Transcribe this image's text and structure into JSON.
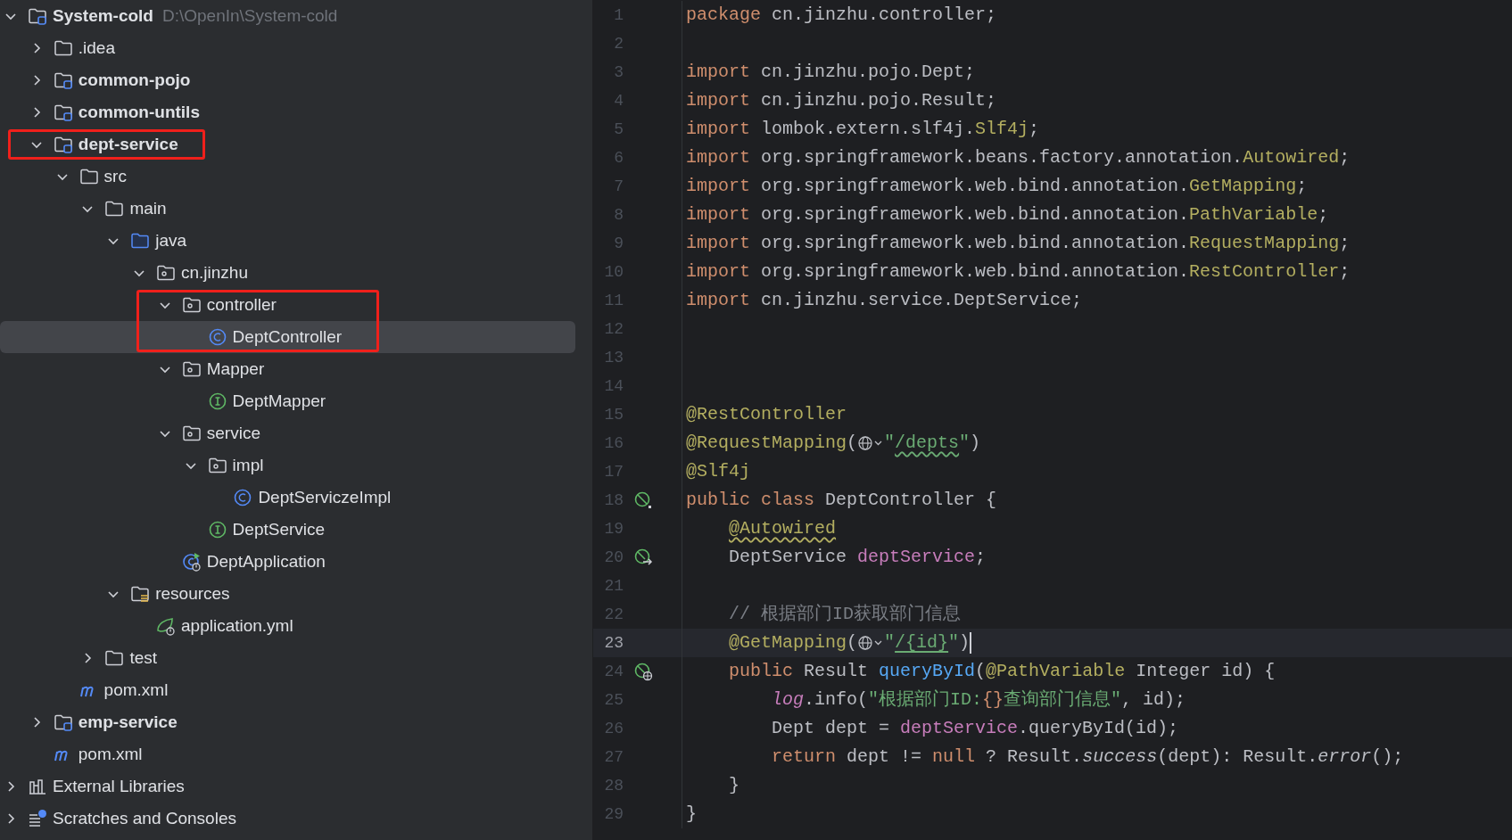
{
  "project_tree": [
    {
      "label": "System-cold",
      "path": "D:\\OpenIn\\System-cold",
      "kind": "module",
      "expanded": true,
      "selected": false,
      "outlined": false,
      "children": [
        {
          "label": ".idea",
          "kind": "folder",
          "expanded": false,
          "selected": false,
          "outlined": false
        },
        {
          "label": "common-pojo",
          "kind": "module",
          "expanded": false,
          "selected": false,
          "outlined": false
        },
        {
          "label": "common-untils",
          "kind": "module",
          "expanded": false,
          "selected": false,
          "outlined": false
        },
        {
          "label": "dept-service",
          "kind": "module",
          "expanded": true,
          "selected": false,
          "outlined": true,
          "children": [
            {
              "label": "src",
              "kind": "folder",
              "expanded": true,
              "selected": false,
              "outlined": false,
              "children": [
                {
                  "label": "main",
                  "kind": "folder",
                  "expanded": true,
                  "selected": false,
                  "outlined": false,
                  "children": [
                    {
                      "label": "java",
                      "kind": "source-root",
                      "expanded": true,
                      "selected": false,
                      "outlined": false,
                      "children": [
                        {
                          "label": "cn.jinzhu",
                          "kind": "package",
                          "expanded": true,
                          "selected": false,
                          "outlined": false,
                          "children": [
                            {
                              "label": "controller",
                              "kind": "package",
                              "expanded": true,
                              "selected": false,
                              "outlined": true,
                              "children": [
                                {
                                  "label": "DeptController",
                                  "kind": "class",
                                  "selected": true,
                                  "outlined": true
                                }
                              ]
                            },
                            {
                              "label": "Mapper",
                              "kind": "package",
                              "expanded": true,
                              "selected": false,
                              "outlined": false,
                              "children": [
                                {
                                  "label": "DeptMapper",
                                  "kind": "interface",
                                  "selected": false,
                                  "outlined": false
                                }
                              ]
                            },
                            {
                              "label": "service",
                              "kind": "package",
                              "expanded": true,
                              "selected": false,
                              "outlined": false,
                              "children": [
                                {
                                  "label": "impl",
                                  "kind": "package",
                                  "expanded": true,
                                  "selected": false,
                                  "outlined": false,
                                  "children": [
                                    {
                                      "label": "DeptServiczeImpl",
                                      "kind": "class",
                                      "selected": false,
                                      "outlined": false
                                    }
                                  ]
                                },
                                {
                                  "label": "DeptService",
                                  "kind": "interface",
                                  "selected": false,
                                  "outlined": false
                                }
                              ]
                            },
                            {
                              "label": "DeptApplication",
                              "kind": "app-class",
                              "selected": false,
                              "outlined": false
                            }
                          ]
                        }
                      ]
                    },
                    {
                      "label": "resources",
                      "kind": "resources",
                      "expanded": true,
                      "selected": false,
                      "outlined": false,
                      "children": [
                        {
                          "label": "application.yml",
                          "kind": "yml",
                          "selected": false,
                          "outlined": false
                        }
                      ]
                    }
                  ]
                },
                {
                  "label": "test",
                  "kind": "folder",
                  "expanded": false,
                  "selected": false,
                  "outlined": false
                }
              ]
            },
            {
              "label": "pom.xml",
              "kind": "maven",
              "selected": false,
              "outlined": false
            }
          ]
        },
        {
          "label": "emp-service",
          "kind": "module",
          "expanded": false,
          "selected": false,
          "outlined": false
        },
        {
          "label": "pom.xml",
          "kind": "maven",
          "selected": false,
          "outlined": false
        }
      ]
    },
    {
      "label": "External Libraries",
      "kind": "libraries",
      "expanded": false,
      "selected": false,
      "outlined": false
    },
    {
      "label": "Scratches and Consoles",
      "kind": "scratches",
      "expanded": false,
      "selected": false,
      "outlined": false
    }
  ],
  "editor": {
    "lines": [
      {
        "number": "1",
        "current": false,
        "tokens": [
          {
            "kind": "kw",
            "t": "package"
          },
          {
            "kind": "plain",
            "t": " cn.jinzhu.controller;"
          }
        ]
      },
      {
        "number": "2",
        "current": false
      },
      {
        "number": "3",
        "current": false,
        "tokens": [
          {
            "kind": "kw",
            "t": "import"
          },
          {
            "kind": "plain",
            "t": " cn.jinzhu.pojo.Dept;"
          }
        ]
      },
      {
        "number": "4",
        "current": false,
        "tokens": [
          {
            "kind": "kw",
            "t": "import"
          },
          {
            "kind": "plain",
            "t": " cn.jinzhu.pojo.Result;"
          }
        ]
      },
      {
        "number": "5",
        "current": false,
        "tokens": [
          {
            "kind": "kw",
            "t": "import"
          },
          {
            "kind": "plain",
            "t": " lombok.extern.slf4j."
          },
          {
            "kind": "ann",
            "t": "Slf4j"
          },
          {
            "kind": "plain",
            "t": ";"
          }
        ]
      },
      {
        "number": "6",
        "current": false,
        "tokens": [
          {
            "kind": "kw",
            "t": "import"
          },
          {
            "kind": "plain",
            "t": " org.springframework.beans.factory.annotation."
          },
          {
            "kind": "ann",
            "t": "Autowired"
          },
          {
            "kind": "plain",
            "t": ";"
          }
        ]
      },
      {
        "number": "7",
        "current": false,
        "tokens": [
          {
            "kind": "kw",
            "t": "import"
          },
          {
            "kind": "plain",
            "t": " org.springframework.web.bind.annotation."
          },
          {
            "kind": "ann",
            "t": "GetMapping"
          },
          {
            "kind": "plain",
            "t": ";"
          }
        ]
      },
      {
        "number": "8",
        "current": false,
        "tokens": [
          {
            "kind": "kw",
            "t": "import"
          },
          {
            "kind": "plain",
            "t": " org.springframework.web.bind.annotation."
          },
          {
            "kind": "ann",
            "t": "PathVariable"
          },
          {
            "kind": "plain",
            "t": ";"
          }
        ]
      },
      {
        "number": "9",
        "current": false,
        "tokens": [
          {
            "kind": "kw",
            "t": "import"
          },
          {
            "kind": "plain",
            "t": " org.springframework.web.bind.annotation."
          },
          {
            "kind": "ann",
            "t": "RequestMapping"
          },
          {
            "kind": "plain",
            "t": ";"
          }
        ]
      },
      {
        "number": "10",
        "current": false,
        "tokens": [
          {
            "kind": "kw",
            "t": "import"
          },
          {
            "kind": "plain",
            "t": " org.springframework.web.bind.annotation."
          },
          {
            "kind": "ann",
            "t": "RestController"
          },
          {
            "kind": "plain",
            "t": ";"
          }
        ]
      },
      {
        "number": "11",
        "current": false,
        "tokens": [
          {
            "kind": "kw",
            "t": "import"
          },
          {
            "kind": "plain",
            "t": " cn.jinzhu.service.DeptService;"
          }
        ]
      },
      {
        "number": "12",
        "current": false
      },
      {
        "number": "13",
        "current": false
      },
      {
        "number": "14",
        "current": false
      },
      {
        "number": "15",
        "current": false,
        "tokens": [
          {
            "kind": "ann",
            "t": "@RestController"
          }
        ]
      },
      {
        "number": "16",
        "current": false,
        "tokens": [
          {
            "kind": "ann",
            "t": "@RequestMapping"
          },
          {
            "kind": "plain",
            "t": "("
          },
          {
            "kind": "globe"
          },
          {
            "kind": "str",
            "t": "\""
          },
          {
            "kind": "url-warn",
            "t": "/depts"
          },
          {
            "kind": "str",
            "t": "\""
          },
          {
            "kind": "plain",
            "t": ")"
          }
        ]
      },
      {
        "number": "17",
        "current": false,
        "tokens": [
          {
            "kind": "ann",
            "t": "@Slf4j"
          }
        ]
      },
      {
        "number": "18",
        "current": false,
        "gutter": {
          "kind": "bean"
        },
        "tokens": [
          {
            "kind": "kw",
            "t": "public class"
          },
          {
            "kind": "plain",
            "t": " DeptController {"
          }
        ]
      },
      {
        "number": "19",
        "current": false,
        "tokens": [
          {
            "kind": "ann-warn",
            "t": "    @Autowired"
          }
        ]
      },
      {
        "number": "20",
        "current": false,
        "gutter": {
          "kind": "autowired"
        },
        "tokens": [
          {
            "kind": "plain",
            "t": "    DeptService "
          },
          {
            "kind": "field",
            "t": "deptService"
          },
          {
            "kind": "plain",
            "t": ";"
          }
        ]
      },
      {
        "number": "21",
        "current": false
      },
      {
        "number": "22",
        "current": false,
        "tokens": [
          {
            "kind": "comment",
            "t": "    // 根据部门ID获取部门信息"
          }
        ]
      },
      {
        "number": "23",
        "current": true,
        "cursor": true,
        "tokens": [
          {
            "kind": "ann",
            "t": "    @GetMapping"
          },
          {
            "kind": "plain",
            "t": "("
          },
          {
            "kind": "globe"
          },
          {
            "kind": "str",
            "t": "\""
          },
          {
            "kind": "url",
            "t": "/{id}"
          },
          {
            "kind": "str",
            "t": "\""
          },
          {
            "kind": "plain",
            "t": ")"
          }
        ]
      },
      {
        "number": "24",
        "current": false,
        "gutter": {
          "kind": "endpoint"
        },
        "tokens": [
          {
            "kind": "kw",
            "t": "    public"
          },
          {
            "kind": "plain",
            "t": " Result "
          },
          {
            "kind": "method",
            "t": "queryById"
          },
          {
            "kind": "plain",
            "t": "("
          },
          {
            "kind": "ann",
            "t": "@PathVariable"
          },
          {
            "kind": "plain",
            "t": " Integer id) {"
          }
        ]
      },
      {
        "number": "25",
        "current": false,
        "tokens": [
          {
            "kind": "static-field",
            "t": "        log"
          },
          {
            "kind": "plain",
            "t": ".info("
          },
          {
            "kind": "str",
            "t": "\"根据部门ID:"
          },
          {
            "kind": "brace",
            "t": "{}"
          },
          {
            "kind": "str",
            "t": "查询部门信息\""
          },
          {
            "kind": "plain",
            "t": ", id);"
          }
        ]
      },
      {
        "number": "26",
        "current": false,
        "tokens": [
          {
            "kind": "plain",
            "t": "        Dept dept = "
          },
          {
            "kind": "field",
            "t": "deptService"
          },
          {
            "kind": "plain",
            "t": ".queryById(id);"
          }
        ]
      },
      {
        "number": "27",
        "current": false,
        "tokens": [
          {
            "kind": "kw",
            "t": "        return"
          },
          {
            "kind": "plain",
            "t": " dept != "
          },
          {
            "kind": "kw",
            "t": "null"
          },
          {
            "kind": "plain",
            "t": " ? Result."
          },
          {
            "kind": "static-call",
            "t": "success"
          },
          {
            "kind": "plain",
            "t": "(dept): Result."
          },
          {
            "kind": "static-call",
            "t": "error"
          },
          {
            "kind": "plain",
            "t": "();"
          }
        ]
      },
      {
        "number": "28",
        "current": false,
        "tokens": [
          {
            "kind": "plain",
            "t": "    }"
          }
        ]
      },
      {
        "number": "29",
        "current": false,
        "tokens": [
          {
            "kind": "plain",
            "t": "}"
          }
        ]
      }
    ]
  }
}
